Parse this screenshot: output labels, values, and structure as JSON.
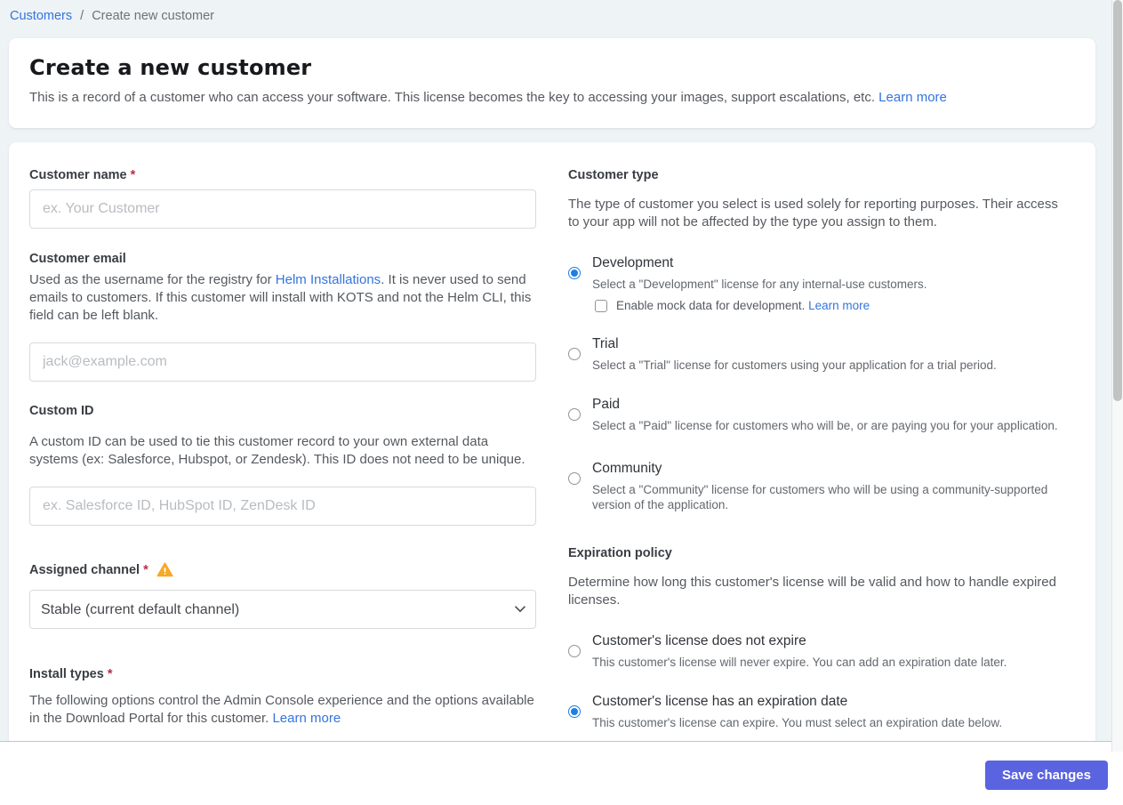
{
  "colors": {
    "link": "#3474dd",
    "radio": "#1e7fe3",
    "button": "#5a63e0",
    "required": "#bc2c43",
    "warning": "#f7a825"
  },
  "ui": {
    "required_mark": "*"
  },
  "breadcrumb": {
    "link": "Customers",
    "separator": "/",
    "current": "Create new customer"
  },
  "header": {
    "title": "Create a new customer",
    "description": "This is a record of a customer who can access your software. This license becomes the key to accessing your images, support escalations, etc.",
    "learn_more": "Learn more"
  },
  "form": {
    "customer_name": {
      "label": "Customer name",
      "placeholder": "ex. Your Customer"
    },
    "customer_email": {
      "label": "Customer email",
      "desc_before_link": "Used as the username for the registry for ",
      "link": "Helm Installations",
      "desc_after_link": ". It is never used to send emails to customers. If this customer will install with KOTS and not the Helm CLI, this field can be left blank.",
      "placeholder": "jack@example.com"
    },
    "custom_id": {
      "label": "Custom ID",
      "description": "A custom ID can be used to tie this customer record to your own external data systems (ex: Salesforce, Hubspot, or Zendesk). This ID does not need to be unique.",
      "placeholder": "ex. Salesforce ID, HubSpot ID, ZenDesk ID"
    },
    "assigned_channel": {
      "label": "Assigned channel",
      "value": "Stable (current default channel)"
    },
    "install_types": {
      "label": "Install types",
      "description": "The following options control the Admin Console experience and the options available in the Download Portal for this customer.",
      "learn_more": "Learn more"
    }
  },
  "customer_type": {
    "heading": "Customer type",
    "description": "The type of customer you select is used solely for reporting purposes. Their access to your app will not be affected by the type you assign to them.",
    "options": [
      {
        "label": "Development",
        "description": "Select a \"Development\" license for any internal-use customers.",
        "selected": true,
        "mock_checkbox": {
          "label": "Enable mock data for development.",
          "learn_more": "Learn more",
          "checked": false
        }
      },
      {
        "label": "Trial",
        "description": "Select a \"Trial\" license for customers using your application for a trial period.",
        "selected": false
      },
      {
        "label": "Paid",
        "description": "Select a \"Paid\" license for customers who will be, or are paying you for your application.",
        "selected": false
      },
      {
        "label": "Community",
        "description": "Select a \"Community\" license for customers who will be using a community-supported version of the application.",
        "selected": false
      }
    ]
  },
  "expiration_policy": {
    "heading": "Expiration policy",
    "description": "Determine how long this customer's license will be valid and how to handle expired licenses.",
    "options": [
      {
        "label": "Customer's license does not expire",
        "description": "This customer's license will never expire. You can add an expiration date later.",
        "selected": false
      },
      {
        "label": "Customer's license has an expiration date",
        "description": "This customer's license can expire. You must select an expiration date below.",
        "selected": true
      }
    ]
  },
  "footer": {
    "save_label": "Save changes"
  }
}
